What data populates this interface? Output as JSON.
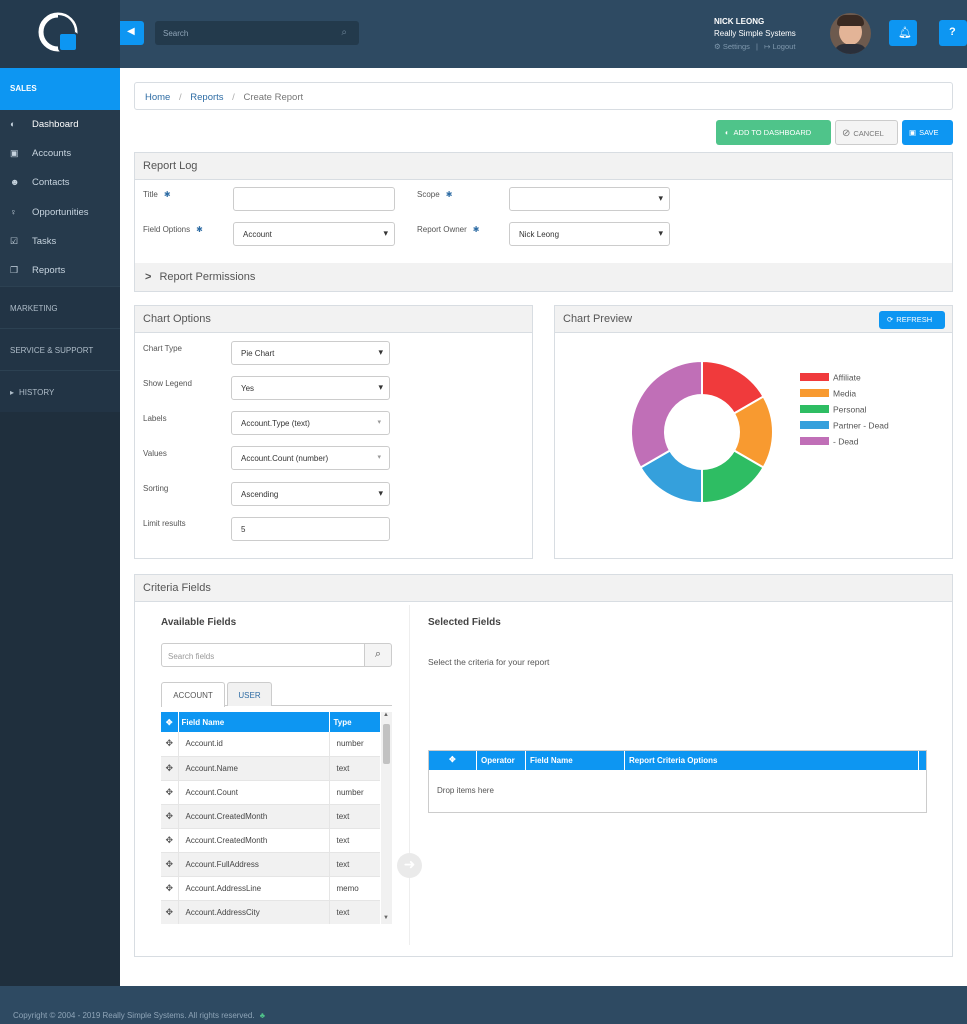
{
  "topbar": {
    "search_placeholder": "Search",
    "user_name": "NICK LEONG",
    "company": "Really Simple Systems",
    "settings_label": "Settings",
    "separator": "|",
    "logout_label": "Logout"
  },
  "sidebar": {
    "section_sales": "SALES",
    "items": [
      {
        "label": "Dashboard",
        "icon": "dashboard-icon"
      },
      {
        "label": "Accounts",
        "icon": "briefcase-icon"
      },
      {
        "label": "Contacts",
        "icon": "users-icon"
      },
      {
        "label": "Opportunities",
        "icon": "lightbulb-icon"
      },
      {
        "label": "Tasks",
        "icon": "checkbox-icon"
      },
      {
        "label": "Reports",
        "icon": "files-icon"
      }
    ],
    "section_marketing": "MARKETING",
    "section_service": "SERVICE & SUPPORT",
    "section_history": "HISTORY"
  },
  "breadcrumb": {
    "home": "Home",
    "reports": "Reports",
    "current": "Create Report",
    "sep": "/"
  },
  "actions": {
    "add_dashboard": "ADD TO DASHBOARD",
    "cancel": "CANCEL",
    "save": "SAVE"
  },
  "report_log": {
    "title": "Report Log",
    "title_label": "Title",
    "scope_label": "Scope",
    "field_options_label": "Field Options",
    "field_options_value": "Account",
    "report_owner_label": "Report Owner",
    "report_owner_value": "Nick Leong",
    "permissions_label": "Report Permissions"
  },
  "chart_options": {
    "title": "Chart Options",
    "chart_type_label": "Chart Type",
    "chart_type_value": "Pie Chart",
    "show_legend_label": "Show Legend",
    "show_legend_value": "Yes",
    "labels_label": "Labels",
    "labels_value": "Account.Type (text)",
    "values_label": "Values",
    "values_value": "Account.Count (number)",
    "sorting_label": "Sorting",
    "sorting_value": "Ascending",
    "limit_label": "Limit results",
    "limit_value": "5"
  },
  "chart_preview": {
    "title": "Chart Preview",
    "refresh_label": "REFRESH"
  },
  "chart_data": {
    "type": "pie",
    "donut": true,
    "categories": [
      "Affiliate",
      "Media",
      "Personal",
      "Partner - Dead",
      "- Dead"
    ],
    "values": [
      1,
      1,
      1,
      1,
      2
    ],
    "colors": [
      "#f03a3c",
      "#f89a30",
      "#2ebd63",
      "#35a0dc",
      "#c06fb7"
    ],
    "legend_position": "right"
  },
  "criteria": {
    "title": "Criteria Fields",
    "available_title": "Available Fields",
    "search_placeholder": "Search fields",
    "tabs": [
      "ACCOUNT",
      "USER"
    ],
    "col_field": "Field Name",
    "col_type": "Type",
    "fields": [
      {
        "name": "Account.id",
        "type": "number"
      },
      {
        "name": "Account.Name",
        "type": "text"
      },
      {
        "name": "Account.Count",
        "type": "number"
      },
      {
        "name": "Account.CreatedMonth",
        "type": "text"
      },
      {
        "name": "Account.CreatedMonth",
        "type": "text"
      },
      {
        "name": "Account.FullAddress",
        "type": "text"
      },
      {
        "name": "Account.AddressLine",
        "type": "memo"
      },
      {
        "name": "Account.AddressCity",
        "type": "text"
      }
    ],
    "selected_title": "Selected Fields",
    "selected_hint": "Select the criteria for your report",
    "sel_col_operator": "Operator",
    "sel_col_field": "Field Name",
    "sel_col_options": "Report Criteria Options",
    "drop_hint": "Drop items here"
  },
  "footer": {
    "copyright": "Copyright © 2004 - 2019 Really Simple Systems. All rights reserved."
  }
}
